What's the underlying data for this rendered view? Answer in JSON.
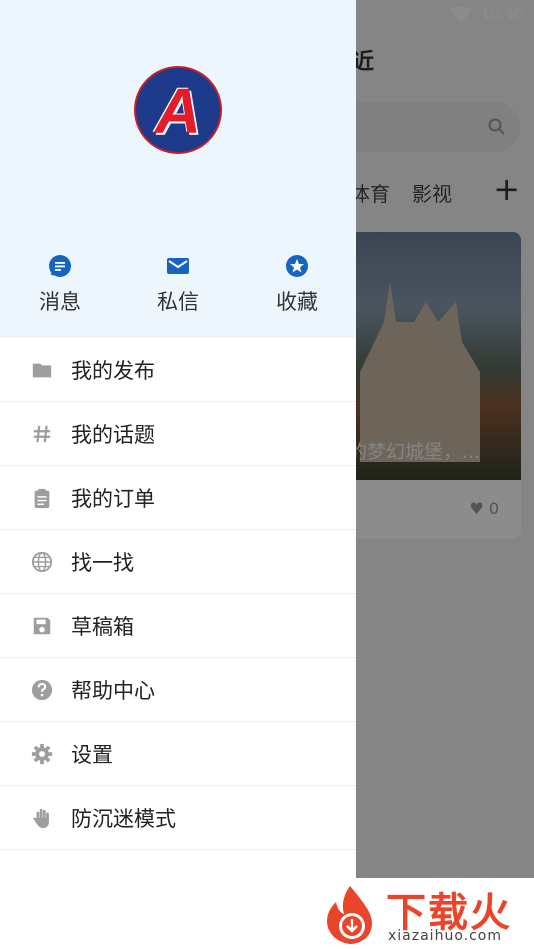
{
  "status_bar": {
    "time": "10:40"
  },
  "background": {
    "title": "附近",
    "tabs": [
      "体育",
      "影视"
    ],
    "caption": "的梦幻城堡，...",
    "like_count": "0"
  },
  "drawer": {
    "quick_actions": [
      {
        "label": "消息",
        "icon": "chat-icon"
      },
      {
        "label": "私信",
        "icon": "mail-icon"
      },
      {
        "label": "收藏",
        "icon": "star-icon"
      }
    ],
    "menu": [
      {
        "label": "我的发布",
        "icon": "folder-icon"
      },
      {
        "label": "我的话题",
        "icon": "hashtag-icon"
      },
      {
        "label": "我的订单",
        "icon": "clipboard-icon"
      },
      {
        "label": "找一找",
        "icon": "globe-icon"
      },
      {
        "label": "草稿箱",
        "icon": "save-icon"
      },
      {
        "label": "帮助中心",
        "icon": "help-icon"
      },
      {
        "label": "设置",
        "icon": "gear-icon"
      },
      {
        "label": "防沉迷模式",
        "icon": "hand-icon"
      }
    ]
  },
  "watermark": {
    "text": "下载火",
    "url": "xiazaihuo.com"
  },
  "colors": {
    "accent": "#1565c0",
    "header_bg": "#eef6fd",
    "icon_gray": "#9e9e9e"
  }
}
